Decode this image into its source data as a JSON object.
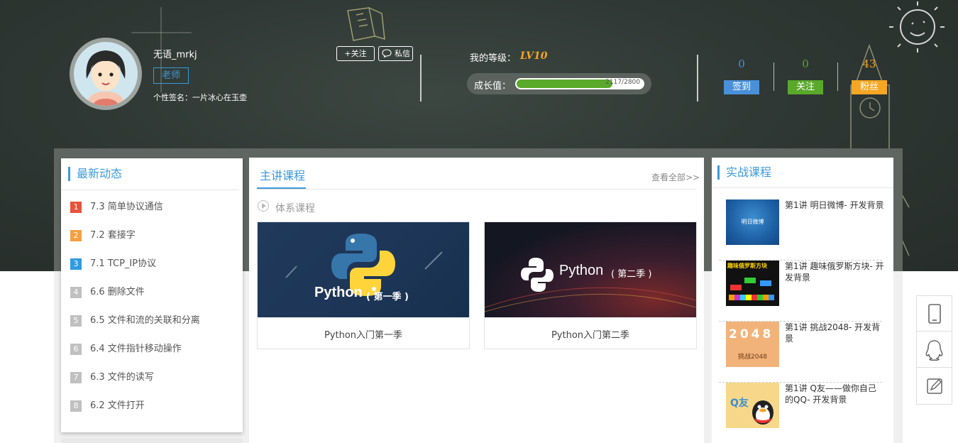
{
  "profile": {
    "username": "无语_mrkj",
    "role": "老师",
    "signature": "个性签名：一片冰心在玉壶",
    "follow_label": "+关注",
    "message_label": "私信"
  },
  "level": {
    "label": "我的等级：",
    "value": "LV10",
    "growth_label": "成长值：",
    "growth_text": "2117/2800",
    "growth_fraction": 0.756
  },
  "stats": [
    {
      "count": "0",
      "label": "签到",
      "color": "#4a90d9"
    },
    {
      "count": "0",
      "label": "关注",
      "color": "#59a82a"
    },
    {
      "count": "43",
      "label": "粉丝",
      "color": "#f5a623"
    }
  ],
  "recent": {
    "title": "最新动态",
    "items": [
      {
        "num": "1",
        "text": "7.3 简单协议通信",
        "color": "#e8533b"
      },
      {
        "num": "2",
        "text": "7.2 套接字",
        "color": "#f5a042"
      },
      {
        "num": "3",
        "text": "7.1 TCP_IP协议",
        "color": "#2f9be0"
      },
      {
        "num": "4",
        "text": "6.6 删除文件",
        "color": "#c0c0c0"
      },
      {
        "num": "5",
        "text": "6.5 文件和流的关联和分离",
        "color": "#c0c0c0"
      },
      {
        "num": "6",
        "text": "6.4 文件指针移动操作",
        "color": "#c0c0c0"
      },
      {
        "num": "7",
        "text": "6.3 文件的读写",
        "color": "#c0c0c0"
      },
      {
        "num": "8",
        "text": "6.2 文件打开",
        "color": "#c0c0c0"
      }
    ]
  },
  "courses": {
    "tab_label": "主讲课程",
    "view_all": "查看全部>>",
    "section_label": "体系课程",
    "cards": [
      {
        "title": "Python入门第一季",
        "banner_word": "Python",
        "banner_season": "( 第一季 )"
      },
      {
        "title": "Python入门第二季",
        "banner_word": "Python",
        "banner_season": "( 第二季 )"
      }
    ]
  },
  "practice": {
    "title": "实战课程",
    "items": [
      {
        "text": "第1讲 明日微博- 开发背景",
        "thumb_caption": "明日微博"
      },
      {
        "text": "第1讲 趣味俄罗斯方块- 开发背景",
        "thumb_caption": "趣味俄罗斯方块"
      },
      {
        "text": "第1讲 挑战2048- 开发背景",
        "thumb_caption": "挑战2048",
        "thumb_digits": "2048"
      },
      {
        "text": "第1讲 Q友——做你自己的QQ- 开发背景",
        "thumb_caption": "Q友"
      }
    ]
  },
  "sidebar_icons": [
    "phone-icon",
    "qq-icon",
    "edit-icon"
  ]
}
